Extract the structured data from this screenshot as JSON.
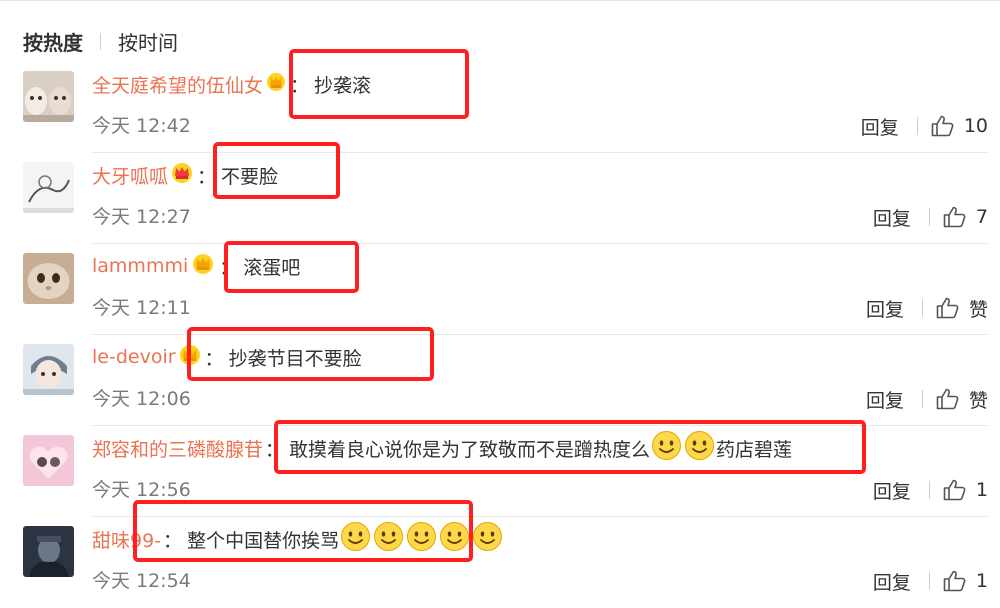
{
  "sort": {
    "hot_label": "按热度",
    "time_label": "按时间"
  },
  "colors": {
    "username": "#eb7350",
    "highlight_box": "#ff1f1f",
    "text": "#333333",
    "muted": "#7a7a7a"
  },
  "comments": [
    {
      "username": "全天庭希望的伍仙女",
      "colon": "：",
      "text_before": "抄袭滚",
      "emojis": [],
      "text_after": "",
      "time": "今天 12:42",
      "reply_label": "回复",
      "like_label": "10",
      "vip": "crown-icon",
      "avatar": "cat-photo"
    },
    {
      "username": "大牙呱呱",
      "colon": "：",
      "text_before": "不要脸",
      "emojis": [],
      "text_after": "",
      "time": "今天 12:27",
      "reply_label": "回复",
      "like_label": "7",
      "vip": "crown-icon",
      "avatar": "sketch-photo"
    },
    {
      "username": "lammmmi",
      "colon": "：",
      "text_before": "滚蛋吧",
      "emojis": [],
      "text_after": "",
      "time": "今天 12:11",
      "reply_label": "回复",
      "like_label": "赞",
      "vip": "crown-icon",
      "avatar": "cat-face-photo"
    },
    {
      "username": "le-devoir",
      "colon": "：",
      "text_before": "抄袭节目不要脸",
      "emojis": [],
      "text_after": "",
      "time": "今天 12:06",
      "reply_label": "回复",
      "like_label": "赞",
      "vip": "crown-icon",
      "avatar": "anime-boy-photo"
    },
    {
      "username": "郑容和的三磷酸腺苷",
      "colon": "：",
      "text_before": "敢摸着良心说你是为了致敬而不是蹭热度么",
      "emojis": [
        "smile-emoji",
        "smile-emoji"
      ],
      "text_after": "药店碧莲",
      "time": "今天 12:56",
      "reply_label": "回复",
      "like_label": "1",
      "vip": "",
      "avatar": "pink-couple-photo"
    },
    {
      "username": "甜味99-",
      "colon": "：",
      "text_before": "整个中国替你挨骂",
      "emojis": [
        "smile-emoji",
        "smile-emoji",
        "smile-emoji",
        "smile-emoji",
        "smile-emoji"
      ],
      "text_after": "",
      "time": "今天 12:54",
      "reply_label": "回复",
      "like_label": "1",
      "vip": "",
      "avatar": "dark-person-photo"
    }
  ]
}
